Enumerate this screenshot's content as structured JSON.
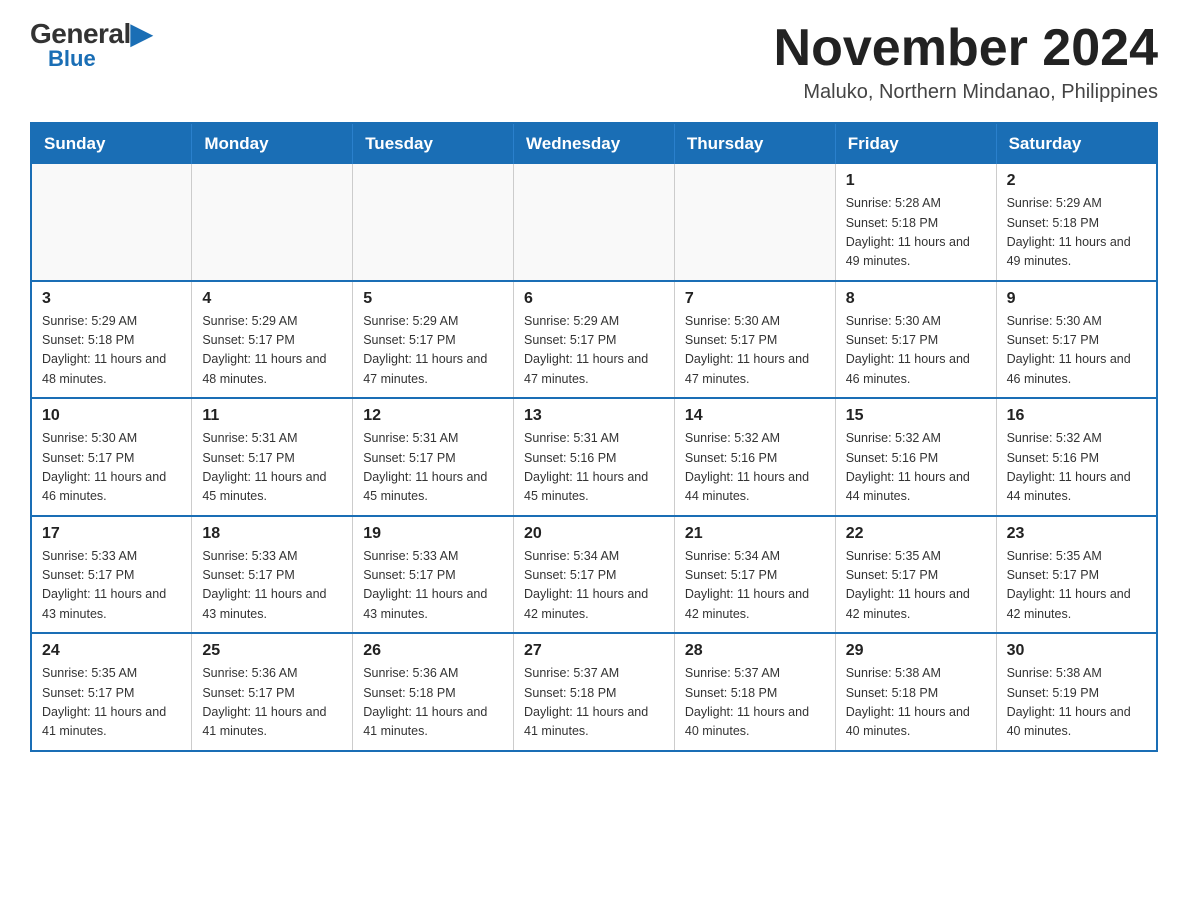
{
  "logo": {
    "general": "General",
    "blue": "Blue"
  },
  "title": {
    "month_year": "November 2024",
    "location": "Maluko, Northern Mindanao, Philippines"
  },
  "days_of_week": [
    "Sunday",
    "Monday",
    "Tuesday",
    "Wednesday",
    "Thursday",
    "Friday",
    "Saturday"
  ],
  "weeks": [
    [
      {
        "day": "",
        "info": ""
      },
      {
        "day": "",
        "info": ""
      },
      {
        "day": "",
        "info": ""
      },
      {
        "day": "",
        "info": ""
      },
      {
        "day": "",
        "info": ""
      },
      {
        "day": "1",
        "info": "Sunrise: 5:28 AM\nSunset: 5:18 PM\nDaylight: 11 hours and 49 minutes."
      },
      {
        "day": "2",
        "info": "Sunrise: 5:29 AM\nSunset: 5:18 PM\nDaylight: 11 hours and 49 minutes."
      }
    ],
    [
      {
        "day": "3",
        "info": "Sunrise: 5:29 AM\nSunset: 5:18 PM\nDaylight: 11 hours and 48 minutes."
      },
      {
        "day": "4",
        "info": "Sunrise: 5:29 AM\nSunset: 5:17 PM\nDaylight: 11 hours and 48 minutes."
      },
      {
        "day": "5",
        "info": "Sunrise: 5:29 AM\nSunset: 5:17 PM\nDaylight: 11 hours and 47 minutes."
      },
      {
        "day": "6",
        "info": "Sunrise: 5:29 AM\nSunset: 5:17 PM\nDaylight: 11 hours and 47 minutes."
      },
      {
        "day": "7",
        "info": "Sunrise: 5:30 AM\nSunset: 5:17 PM\nDaylight: 11 hours and 47 minutes."
      },
      {
        "day": "8",
        "info": "Sunrise: 5:30 AM\nSunset: 5:17 PM\nDaylight: 11 hours and 46 minutes."
      },
      {
        "day": "9",
        "info": "Sunrise: 5:30 AM\nSunset: 5:17 PM\nDaylight: 11 hours and 46 minutes."
      }
    ],
    [
      {
        "day": "10",
        "info": "Sunrise: 5:30 AM\nSunset: 5:17 PM\nDaylight: 11 hours and 46 minutes."
      },
      {
        "day": "11",
        "info": "Sunrise: 5:31 AM\nSunset: 5:17 PM\nDaylight: 11 hours and 45 minutes."
      },
      {
        "day": "12",
        "info": "Sunrise: 5:31 AM\nSunset: 5:17 PM\nDaylight: 11 hours and 45 minutes."
      },
      {
        "day": "13",
        "info": "Sunrise: 5:31 AM\nSunset: 5:16 PM\nDaylight: 11 hours and 45 minutes."
      },
      {
        "day": "14",
        "info": "Sunrise: 5:32 AM\nSunset: 5:16 PM\nDaylight: 11 hours and 44 minutes."
      },
      {
        "day": "15",
        "info": "Sunrise: 5:32 AM\nSunset: 5:16 PM\nDaylight: 11 hours and 44 minutes."
      },
      {
        "day": "16",
        "info": "Sunrise: 5:32 AM\nSunset: 5:16 PM\nDaylight: 11 hours and 44 minutes."
      }
    ],
    [
      {
        "day": "17",
        "info": "Sunrise: 5:33 AM\nSunset: 5:17 PM\nDaylight: 11 hours and 43 minutes."
      },
      {
        "day": "18",
        "info": "Sunrise: 5:33 AM\nSunset: 5:17 PM\nDaylight: 11 hours and 43 minutes."
      },
      {
        "day": "19",
        "info": "Sunrise: 5:33 AM\nSunset: 5:17 PM\nDaylight: 11 hours and 43 minutes."
      },
      {
        "day": "20",
        "info": "Sunrise: 5:34 AM\nSunset: 5:17 PM\nDaylight: 11 hours and 42 minutes."
      },
      {
        "day": "21",
        "info": "Sunrise: 5:34 AM\nSunset: 5:17 PM\nDaylight: 11 hours and 42 minutes."
      },
      {
        "day": "22",
        "info": "Sunrise: 5:35 AM\nSunset: 5:17 PM\nDaylight: 11 hours and 42 minutes."
      },
      {
        "day": "23",
        "info": "Sunrise: 5:35 AM\nSunset: 5:17 PM\nDaylight: 11 hours and 42 minutes."
      }
    ],
    [
      {
        "day": "24",
        "info": "Sunrise: 5:35 AM\nSunset: 5:17 PM\nDaylight: 11 hours and 41 minutes."
      },
      {
        "day": "25",
        "info": "Sunrise: 5:36 AM\nSunset: 5:17 PM\nDaylight: 11 hours and 41 minutes."
      },
      {
        "day": "26",
        "info": "Sunrise: 5:36 AM\nSunset: 5:18 PM\nDaylight: 11 hours and 41 minutes."
      },
      {
        "day": "27",
        "info": "Sunrise: 5:37 AM\nSunset: 5:18 PM\nDaylight: 11 hours and 41 minutes."
      },
      {
        "day": "28",
        "info": "Sunrise: 5:37 AM\nSunset: 5:18 PM\nDaylight: 11 hours and 40 minutes."
      },
      {
        "day": "29",
        "info": "Sunrise: 5:38 AM\nSunset: 5:18 PM\nDaylight: 11 hours and 40 minutes."
      },
      {
        "day": "30",
        "info": "Sunrise: 5:38 AM\nSunset: 5:19 PM\nDaylight: 11 hours and 40 minutes."
      }
    ]
  ]
}
